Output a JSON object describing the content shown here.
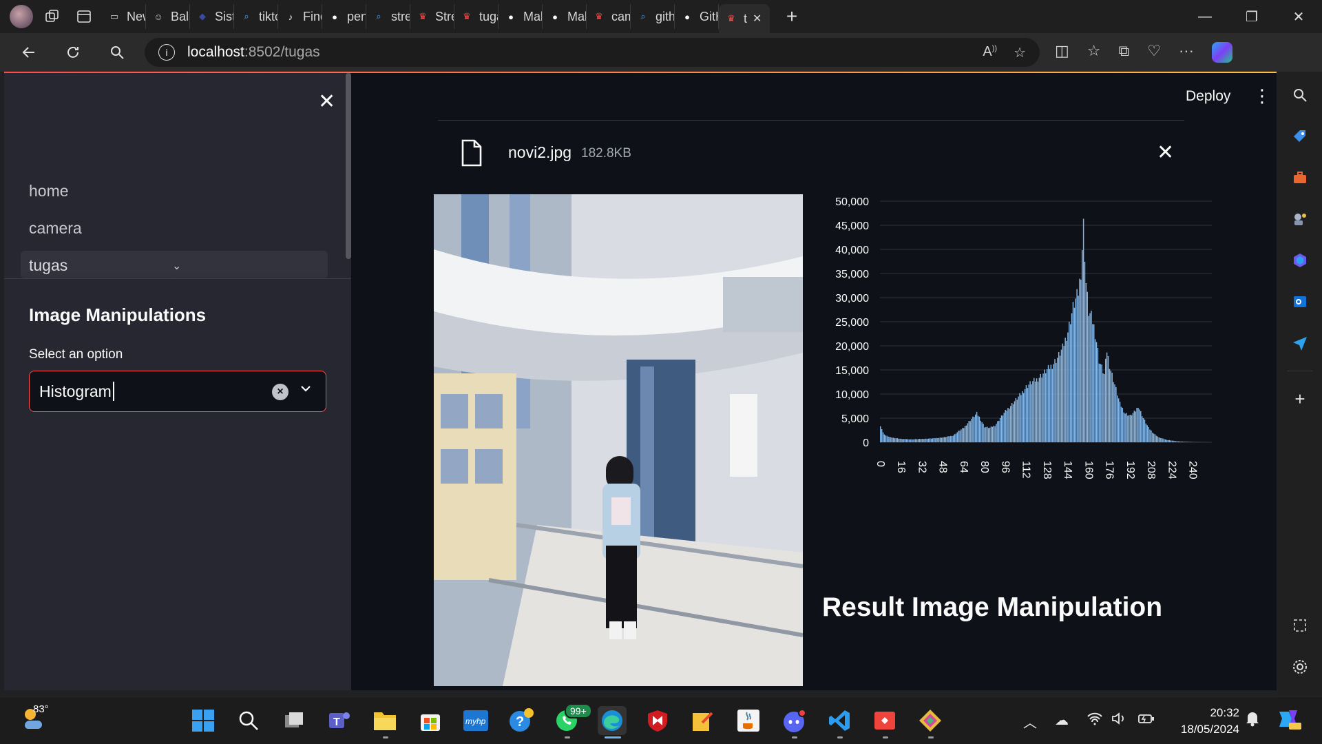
{
  "browser": {
    "tabs": [
      {
        "label": "New",
        "icon": "new-tab-icon"
      },
      {
        "label": "Balsa",
        "icon": "smiley-icon"
      },
      {
        "label": "Siste",
        "icon": "system-icon"
      },
      {
        "label": "tiktol",
        "icon": "search-icon"
      },
      {
        "label": "Find",
        "icon": "tiktok-icon"
      },
      {
        "label": "peng",
        "icon": "github-icon"
      },
      {
        "label": "strea",
        "icon": "search-icon"
      },
      {
        "label": "Strea",
        "icon": "streamlit-icon"
      },
      {
        "label": "tuga",
        "icon": "streamlit-icon"
      },
      {
        "label": "Malil",
        "icon": "github-icon"
      },
      {
        "label": "Malil",
        "icon": "github-icon"
      },
      {
        "label": "came",
        "icon": "streamlit-icon"
      },
      {
        "label": "githu",
        "icon": "search-icon"
      },
      {
        "label": "GitH",
        "icon": "github-icon"
      },
      {
        "label": "t",
        "icon": "streamlit-icon"
      }
    ],
    "url_host": "localhost",
    "url_rest": ":8502/tugas"
  },
  "sidebar": {
    "nav": [
      "home",
      "camera",
      "tugas"
    ],
    "heading": "Image Manipulations",
    "select_label": "Select an option",
    "select_value": "Histogram"
  },
  "main": {
    "deploy_label": "Deploy",
    "file_name": "novi2.jpg",
    "file_size": "182.8KB",
    "result_heading": "Result Image Manipulation"
  },
  "chart_data": {
    "type": "bar",
    "title": "",
    "xlabel": "",
    "ylabel": "",
    "x_ticks": [
      0,
      16,
      32,
      48,
      64,
      80,
      96,
      112,
      128,
      144,
      160,
      176,
      192,
      208,
      224,
      240
    ],
    "y_ticks": [
      "0",
      "5,000",
      "10,000",
      "15,000",
      "20,000",
      "25,000",
      "30,000",
      "35,000",
      "40,000",
      "45,000",
      "50,000"
    ],
    "ylim": [
      0,
      50000
    ],
    "xlim": [
      0,
      255
    ],
    "bar_color": "#83b5e6",
    "grid": true,
    "bins": [
      [
        0,
        3500
      ],
      [
        2,
        2000
      ],
      [
        4,
        1400
      ],
      [
        8,
        1000
      ],
      [
        16,
        700
      ],
      [
        24,
        600
      ],
      [
        32,
        700
      ],
      [
        40,
        800
      ],
      [
        48,
        1000
      ],
      [
        56,
        1400
      ],
      [
        60,
        2300
      ],
      [
        64,
        3000
      ],
      [
        68,
        4300
      ],
      [
        72,
        5400
      ],
      [
        74,
        6000
      ],
      [
        76,
        5200
      ],
      [
        80,
        3200
      ],
      [
        84,
        3000
      ],
      [
        88,
        3500
      ],
      [
        92,
        5000
      ],
      [
        96,
        6400
      ],
      [
        100,
        7600
      ],
      [
        104,
        8800
      ],
      [
        108,
        10000
      ],
      [
        112,
        11500
      ],
      [
        116,
        12400
      ],
      [
        120,
        13000
      ],
      [
        124,
        14000
      ],
      [
        128,
        15000
      ],
      [
        132,
        16000
      ],
      [
        136,
        17500
      ],
      [
        140,
        19500
      ],
      [
        144,
        23000
      ],
      [
        148,
        28000
      ],
      [
        152,
        31000
      ],
      [
        154,
        35500
      ],
      [
        156,
        45000
      ],
      [
        158,
        33000
      ],
      [
        160,
        27000
      ],
      [
        162,
        26000
      ],
      [
        164,
        24000
      ],
      [
        166,
        21000
      ],
      [
        168,
        17000
      ],
      [
        170,
        15500
      ],
      [
        172,
        14000
      ],
      [
        174,
        19000
      ],
      [
        176,
        16000
      ],
      [
        180,
        12000
      ],
      [
        184,
        8000
      ],
      [
        188,
        6000
      ],
      [
        192,
        5500
      ],
      [
        196,
        6500
      ],
      [
        198,
        7500
      ],
      [
        202,
        5000
      ],
      [
        206,
        3000
      ],
      [
        210,
        1800
      ],
      [
        214,
        1000
      ],
      [
        220,
        500
      ],
      [
        228,
        200
      ],
      [
        240,
        50
      ],
      [
        255,
        0
      ]
    ]
  },
  "taskbar": {
    "weather_temp": "83°",
    "time": "20:32",
    "date": "18/05/2024",
    "whatsapp_badge": "99+"
  }
}
